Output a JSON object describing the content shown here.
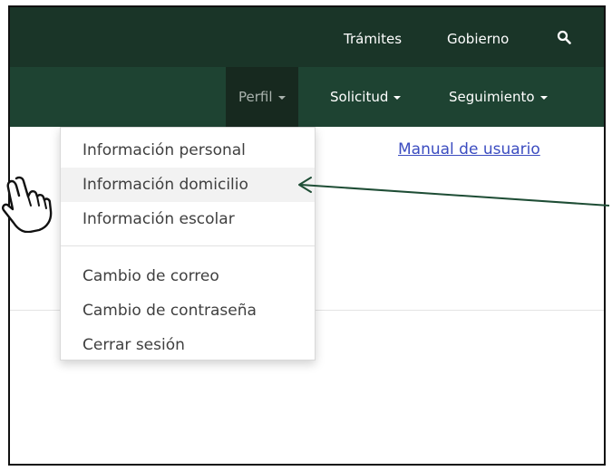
{
  "topbar": {
    "tramites": "Trámites",
    "gobierno": "Gobierno",
    "search_icon": "search-icon"
  },
  "navbar": {
    "perfil": "Perfil",
    "solicitud": "Solicitud",
    "seguimiento": "Seguimiento"
  },
  "dropdown": {
    "items_top": [
      "Información personal",
      "Información domicilio",
      "Información escolar"
    ],
    "items_bottom": [
      "Cambio de correo",
      "Cambio de contraseña",
      "Cerrar sesión"
    ],
    "highlighted": "Información domicilio"
  },
  "content": {
    "manual_link": "Manual de usuario"
  },
  "annotation": {
    "pointer_icon": "hand-pointer-icon",
    "arrow_color": "#1e4d35"
  },
  "colors": {
    "topbar": "#1a3528",
    "navbar": "#1e4332",
    "nav_active": "#17291f",
    "link": "#3b4cc0"
  }
}
